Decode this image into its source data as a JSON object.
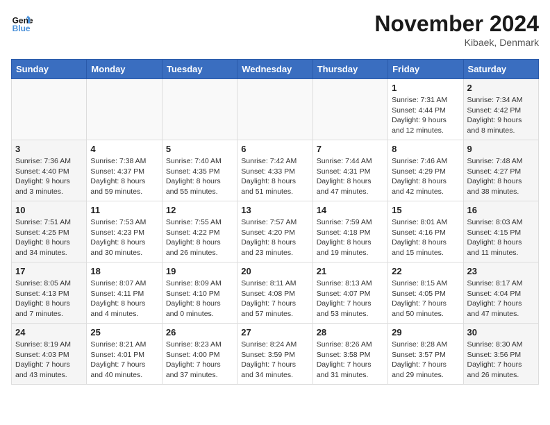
{
  "logo": {
    "line1": "General",
    "line2": "Blue"
  },
  "title": "November 2024",
  "location": "Kibaek, Denmark",
  "days_of_week": [
    "Sunday",
    "Monday",
    "Tuesday",
    "Wednesday",
    "Thursday",
    "Friday",
    "Saturday"
  ],
  "weeks": [
    [
      {
        "day": "",
        "info": ""
      },
      {
        "day": "",
        "info": ""
      },
      {
        "day": "",
        "info": ""
      },
      {
        "day": "",
        "info": ""
      },
      {
        "day": "",
        "info": ""
      },
      {
        "day": "1",
        "info": "Sunrise: 7:31 AM\nSunset: 4:44 PM\nDaylight: 9 hours\nand 12 minutes."
      },
      {
        "day": "2",
        "info": "Sunrise: 7:34 AM\nSunset: 4:42 PM\nDaylight: 9 hours\nand 8 minutes."
      }
    ],
    [
      {
        "day": "3",
        "info": "Sunrise: 7:36 AM\nSunset: 4:40 PM\nDaylight: 9 hours\nand 3 minutes."
      },
      {
        "day": "4",
        "info": "Sunrise: 7:38 AM\nSunset: 4:37 PM\nDaylight: 8 hours\nand 59 minutes."
      },
      {
        "day": "5",
        "info": "Sunrise: 7:40 AM\nSunset: 4:35 PM\nDaylight: 8 hours\nand 55 minutes."
      },
      {
        "day": "6",
        "info": "Sunrise: 7:42 AM\nSunset: 4:33 PM\nDaylight: 8 hours\nand 51 minutes."
      },
      {
        "day": "7",
        "info": "Sunrise: 7:44 AM\nSunset: 4:31 PM\nDaylight: 8 hours\nand 47 minutes."
      },
      {
        "day": "8",
        "info": "Sunrise: 7:46 AM\nSunset: 4:29 PM\nDaylight: 8 hours\nand 42 minutes."
      },
      {
        "day": "9",
        "info": "Sunrise: 7:48 AM\nSunset: 4:27 PM\nDaylight: 8 hours\nand 38 minutes."
      }
    ],
    [
      {
        "day": "10",
        "info": "Sunrise: 7:51 AM\nSunset: 4:25 PM\nDaylight: 8 hours\nand 34 minutes."
      },
      {
        "day": "11",
        "info": "Sunrise: 7:53 AM\nSunset: 4:23 PM\nDaylight: 8 hours\nand 30 minutes."
      },
      {
        "day": "12",
        "info": "Sunrise: 7:55 AM\nSunset: 4:22 PM\nDaylight: 8 hours\nand 26 minutes."
      },
      {
        "day": "13",
        "info": "Sunrise: 7:57 AM\nSunset: 4:20 PM\nDaylight: 8 hours\nand 23 minutes."
      },
      {
        "day": "14",
        "info": "Sunrise: 7:59 AM\nSunset: 4:18 PM\nDaylight: 8 hours\nand 19 minutes."
      },
      {
        "day": "15",
        "info": "Sunrise: 8:01 AM\nSunset: 4:16 PM\nDaylight: 8 hours\nand 15 minutes."
      },
      {
        "day": "16",
        "info": "Sunrise: 8:03 AM\nSunset: 4:15 PM\nDaylight: 8 hours\nand 11 minutes."
      }
    ],
    [
      {
        "day": "17",
        "info": "Sunrise: 8:05 AM\nSunset: 4:13 PM\nDaylight: 8 hours\nand 7 minutes."
      },
      {
        "day": "18",
        "info": "Sunrise: 8:07 AM\nSunset: 4:11 PM\nDaylight: 8 hours\nand 4 minutes."
      },
      {
        "day": "19",
        "info": "Sunrise: 8:09 AM\nSunset: 4:10 PM\nDaylight: 8 hours\nand 0 minutes."
      },
      {
        "day": "20",
        "info": "Sunrise: 8:11 AM\nSunset: 4:08 PM\nDaylight: 7 hours\nand 57 minutes."
      },
      {
        "day": "21",
        "info": "Sunrise: 8:13 AM\nSunset: 4:07 PM\nDaylight: 7 hours\nand 53 minutes."
      },
      {
        "day": "22",
        "info": "Sunrise: 8:15 AM\nSunset: 4:05 PM\nDaylight: 7 hours\nand 50 minutes."
      },
      {
        "day": "23",
        "info": "Sunrise: 8:17 AM\nSunset: 4:04 PM\nDaylight: 7 hours\nand 47 minutes."
      }
    ],
    [
      {
        "day": "24",
        "info": "Sunrise: 8:19 AM\nSunset: 4:03 PM\nDaylight: 7 hours\nand 43 minutes."
      },
      {
        "day": "25",
        "info": "Sunrise: 8:21 AM\nSunset: 4:01 PM\nDaylight: 7 hours\nand 40 minutes."
      },
      {
        "day": "26",
        "info": "Sunrise: 8:23 AM\nSunset: 4:00 PM\nDaylight: 7 hours\nand 37 minutes."
      },
      {
        "day": "27",
        "info": "Sunrise: 8:24 AM\nSunset: 3:59 PM\nDaylight: 7 hours\nand 34 minutes."
      },
      {
        "day": "28",
        "info": "Sunrise: 8:26 AM\nSunset: 3:58 PM\nDaylight: 7 hours\nand 31 minutes."
      },
      {
        "day": "29",
        "info": "Sunrise: 8:28 AM\nSunset: 3:57 PM\nDaylight: 7 hours\nand 29 minutes."
      },
      {
        "day": "30",
        "info": "Sunrise: 8:30 AM\nSunset: 3:56 PM\nDaylight: 7 hours\nand 26 minutes."
      }
    ]
  ]
}
